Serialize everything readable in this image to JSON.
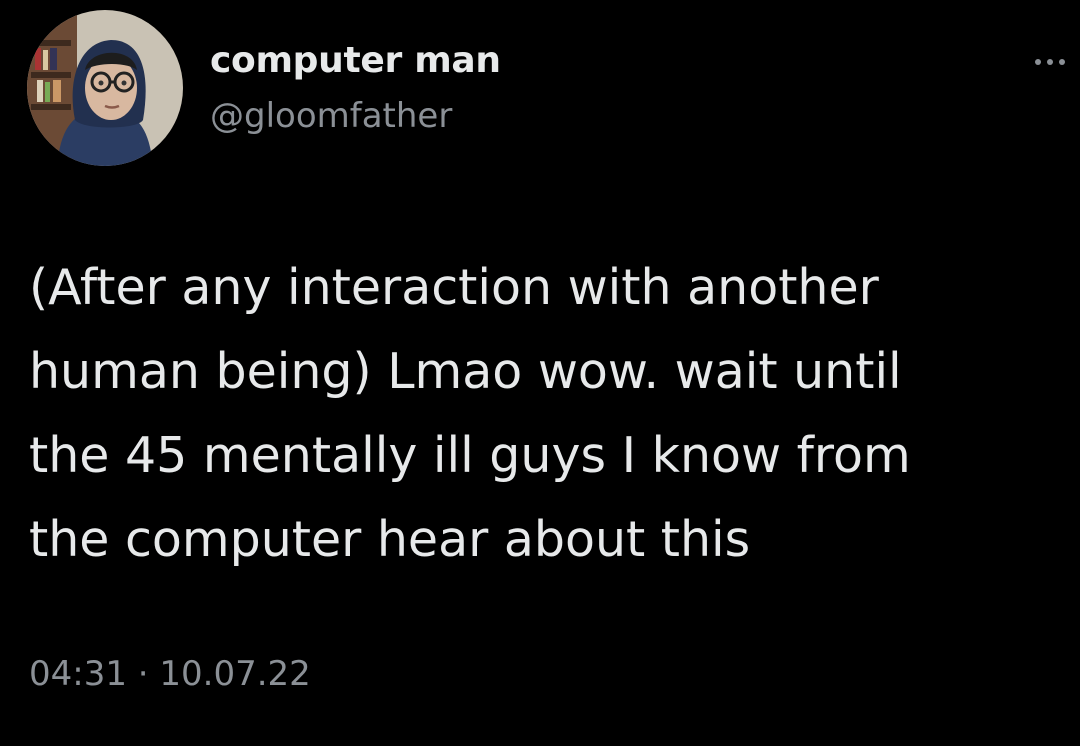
{
  "tweet": {
    "author": {
      "display_name": "computer man",
      "handle": "@gloomfather",
      "avatar_icon": "profile-photo"
    },
    "more_icon": "more-horizontal-icon",
    "text": "(After any interaction with another\nhuman being) Lmao wow. wait until\nthe 45 mentally ill guys I know from\nthe computer hear about this",
    "timestamp": "04:31 · 10.07.22"
  },
  "colors": {
    "background": "#000000",
    "primary_text": "#e7e9ea",
    "secondary_text": "#8b9096"
  }
}
